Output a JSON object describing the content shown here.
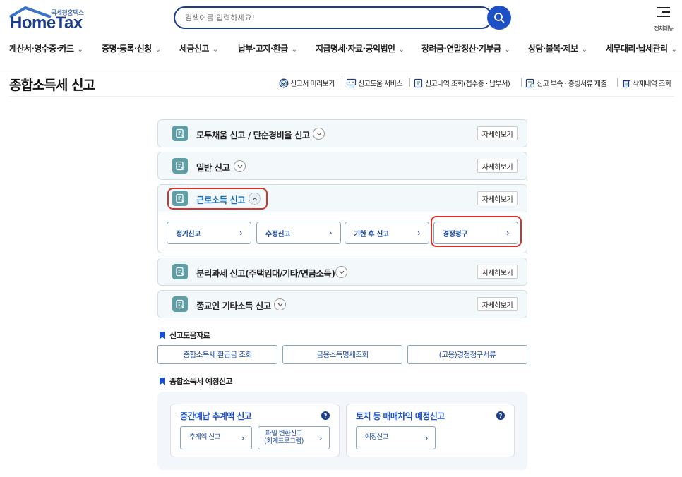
{
  "header": {
    "logo_sub": "국세청홈택스",
    "logo_main": "HomeTax",
    "search_placeholder": "검색어를 입력하세요!",
    "menu_label": "전체메뉴"
  },
  "gnb": [
    "계산서·영수증·카드",
    "증명·등록·신청",
    "세금신고",
    "납부·고지·환급",
    "지급명세·자료·공익법인",
    "장려금·연말정산·기부금",
    "상담·불복·제보",
    "세무대리·납세관리"
  ],
  "page": {
    "title": "종합소득세 신고",
    "quick_links": [
      "신고서 미리보기",
      "신고도움 서비스",
      "신고내역 조회(접수증 · 납부서)",
      "신고 부속 · 증빙서류 제출",
      "삭제내역 조회"
    ]
  },
  "accordions": [
    {
      "title": "모두채움 신고 / 단순경비율 신고",
      "detail": "자세히보기",
      "expanded": false
    },
    {
      "title": "일반 신고",
      "detail": "자세히보기",
      "expanded": false
    },
    {
      "title": "근로소득 신고",
      "detail": "자세히보기",
      "expanded": true,
      "buttons": [
        "정기신고",
        "수정신고",
        "기한 후 신고",
        "경정청구"
      ]
    },
    {
      "title": "분리과세 신고(주택임대/기타/연금소득)",
      "detail": "자세히보기",
      "expanded": false
    },
    {
      "title": "종교인 기타소득 신고",
      "detail": "자세히보기",
      "expanded": false
    }
  ],
  "help": {
    "title": "신고도움자료",
    "buttons": [
      "종합소득세 환급금 조회",
      "금융소득명세조회",
      "(고용)경정청구서류"
    ]
  },
  "preliminary": {
    "title": "종합소득세 예정신고",
    "cards": [
      {
        "title": "중간예납 추계액 신고",
        "buttons": [
          "추계액 신고",
          "파일 변환신고\n(회계프로그램)"
        ]
      },
      {
        "title": "토지 등 매매차익 예정신고",
        "buttons": [
          "예정신고"
        ]
      }
    ]
  },
  "colors": {
    "primary": "#1d4fc5",
    "brand": "#1d3e8a",
    "highlight": "#d8312b",
    "accordion_bg": "#f3f9fa"
  }
}
